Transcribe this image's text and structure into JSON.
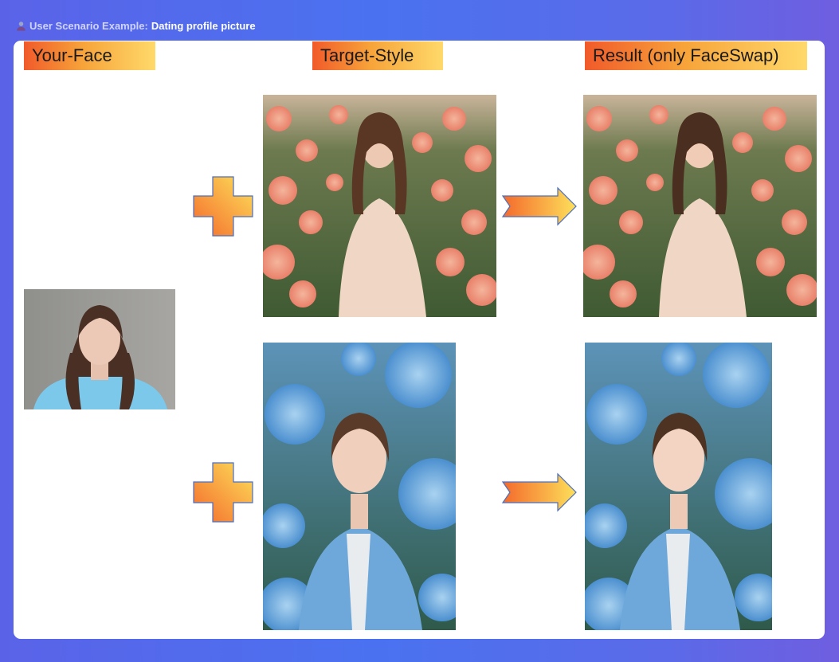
{
  "header": {
    "prefix": "User Scenario Example:",
    "title": "Dating profile picture",
    "icon": "user-icon"
  },
  "labels": {
    "your_face": "Your-Face",
    "target_style": "Target-Style",
    "result": "Result (only FaceSwap)"
  },
  "colors": {
    "background_left": "#5a63e8",
    "background_right": "#6f5ee0",
    "label_gradient_start": "#f15a2a",
    "label_gradient_end": "#ffd96a",
    "symbol_fill_start": "#f46a2c",
    "symbol_fill_end": "#fde05a",
    "symbol_outline": "#4a6fc0"
  },
  "icons": {
    "plus": "plus-symbol-icon",
    "arrow": "right-arrow-icon"
  }
}
